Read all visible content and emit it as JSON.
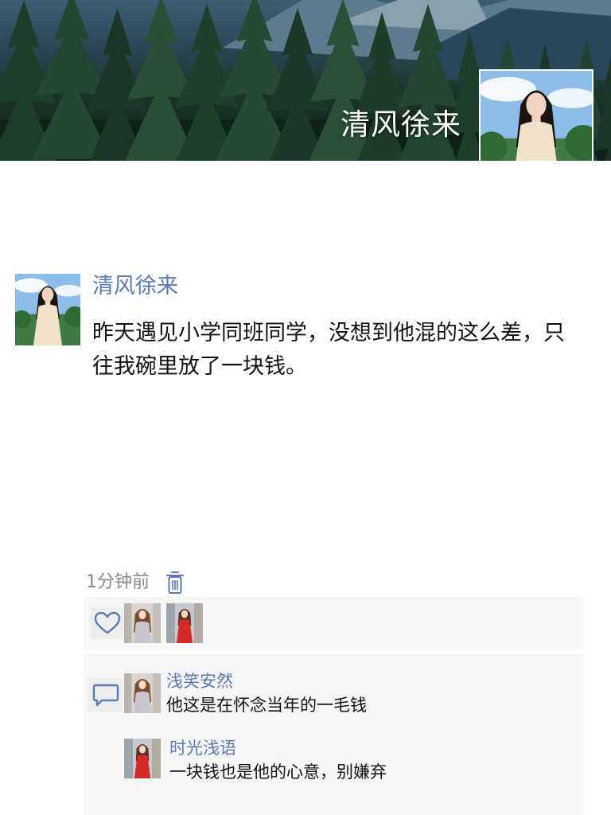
{
  "profile": {
    "cover_image": "evergreen-forest-mountain-photo",
    "name": "清风徐来",
    "avatar": "woman-white-dress-photo"
  },
  "post": {
    "author": "清风徐来",
    "avatar": "woman-white-dress-photo",
    "text": "昨天遇见小学同班同学，没想到他混的这么差，只往我碗里放了一块钱。",
    "time": "1分钟前",
    "delete_icon": "trash-icon"
  },
  "likes": {
    "icon": "heart-icon",
    "users": [
      {
        "avatar": "woman-grey-dress-street-photo"
      },
      {
        "avatar": "woman-red-dress-street-photo"
      }
    ]
  },
  "comments": {
    "icon": "comment-bubble-icon",
    "items": [
      {
        "author": "浅笑安然",
        "avatar": "woman-grey-dress-street-photo",
        "text": "他这是在怀念当年的一毛钱"
      },
      {
        "author": "时光浅语",
        "avatar": "woman-red-dress-street-photo",
        "text": "一块钱也是他的心意，别嫌弃"
      }
    ]
  },
  "colors": {
    "link": "#5b79b2",
    "icon": "#5b79b2",
    "panel_bg": "#f6f6f6",
    "meta_text": "#888888",
    "body_text": "#111111"
  }
}
